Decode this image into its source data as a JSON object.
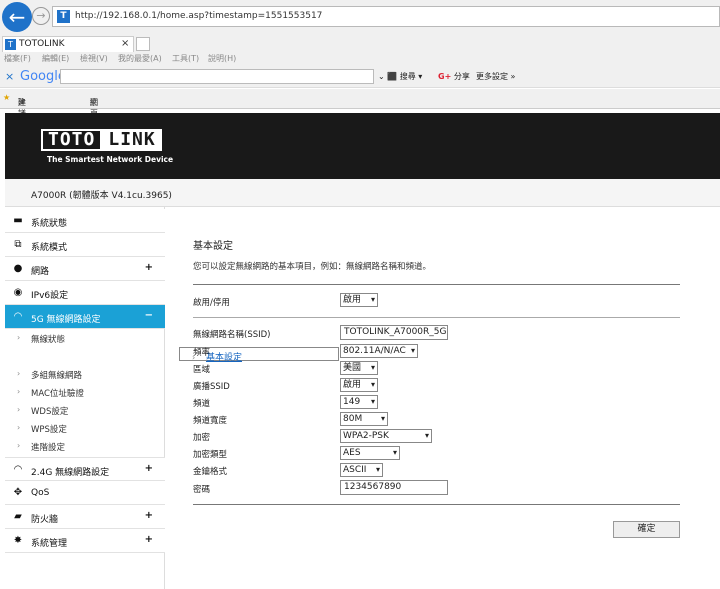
{
  "browser": {
    "url": "http://192.168.0.1/home.asp?timestamp=1551553517",
    "tab_title": "TOTOLINK",
    "menu": [
      "檔案(F)",
      "編輯(E)",
      "檢視(V)",
      "我的最愛(A)",
      "工具(T)",
      "說明(H)"
    ],
    "google": "Google",
    "search_label": "搜尋",
    "share_label": "分享",
    "more_label": "更多設定 »",
    "fav_sites": "建議的網站 ▾",
    "fav_gallery": "網頁快訊圖庫 ▾"
  },
  "header": {
    "logo_left": "TOTO",
    "logo_right": "LINK",
    "tagline": "The Smartest Network Device",
    "model": "A7000R (韌體版本 V4.1cu.3965)"
  },
  "sidebar": {
    "items": [
      {
        "label": "系統狀態",
        "icon": "monitor-icon",
        "plus": ""
      },
      {
        "label": "系統模式",
        "icon": "mode-icon",
        "plus": ""
      },
      {
        "label": "網路",
        "icon": "globe-icon",
        "plus": "+"
      },
      {
        "label": "IPv6設定",
        "icon": "ipv6-icon",
        "plus": ""
      },
      {
        "label": "5G 無線網路設定",
        "icon": "wifi-icon",
        "plus": "−"
      },
      {
        "label": "2.4G 無線網路設定",
        "icon": "wifi-icon",
        "plus": "+"
      },
      {
        "label": "QoS",
        "icon": "qos-icon",
        "plus": ""
      },
      {
        "label": "防火牆",
        "icon": "lock-icon",
        "plus": "+"
      },
      {
        "label": "系統管理",
        "icon": "gear-icon",
        "plus": "+"
      }
    ],
    "sub": [
      "無線狀態",
      "基本設定",
      "多組無線網路",
      "MAC位址驗證",
      "WDS設定",
      "WPS設定",
      "進階設定"
    ]
  },
  "main": {
    "title": "基本設定",
    "desc": "您可以設定無線網路的基本項目，例如：無線網路名稱和頻道。",
    "enable_label": "啟用/停用",
    "enable_value": "啟用",
    "fields": [
      {
        "label": "無線網路名稱(SSID)",
        "value": "TOTOLINK_A7000R_5G",
        "kind": "text"
      },
      {
        "label": "頻率",
        "value": "802.11A/N/AC",
        "kind": "select"
      },
      {
        "label": "區域",
        "value": "美國",
        "kind": "select"
      },
      {
        "label": "廣播SSID",
        "value": "啟用",
        "kind": "select"
      },
      {
        "label": "頻道",
        "value": "149",
        "kind": "select"
      },
      {
        "label": "頻道寬度",
        "value": "80M",
        "kind": "select"
      },
      {
        "label": "加密",
        "value": "WPA2-PSK",
        "kind": "select"
      },
      {
        "label": "加密類型",
        "value": "AES",
        "kind": "select"
      },
      {
        "label": "金鑰格式",
        "value": "ASCII",
        "kind": "select"
      },
      {
        "label": "密碼",
        "value": "1234567890",
        "kind": "text"
      }
    ],
    "ok_label": "確定"
  }
}
